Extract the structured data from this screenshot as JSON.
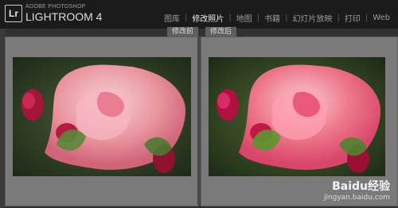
{
  "header": {
    "app_badge": "Lr",
    "brand_small": "ADOBE PHOTOSHOP",
    "brand_large": "LIGHTROOM 4",
    "modules": [
      {
        "label": "图库",
        "active": false
      },
      {
        "label": "修改照片",
        "active": true
      },
      {
        "label": "地图",
        "active": false
      },
      {
        "label": "书籍",
        "active": false
      },
      {
        "label": "幻灯片放映",
        "active": false
      },
      {
        "label": "打印",
        "active": false
      },
      {
        "label": "Web",
        "active": false
      }
    ],
    "separator": "|"
  },
  "compare": {
    "before_label": "修改前",
    "after_label": "修改后"
  },
  "watermark": {
    "logo": "Baidu经验",
    "url": "jingyan.baidu.com"
  },
  "colors": {
    "header_bg": "#1b1b1b",
    "panel_bg": "#7a7a7a",
    "active_module": "#e9e9e9",
    "inactive_module": "#9a9a9a",
    "rose_before": "#f39aa6",
    "rose_after": "#f57a8f"
  },
  "icons": {
    "app_logo": "lightroom-logo-icon",
    "watermark_logo": "baidu-paw-icon"
  }
}
